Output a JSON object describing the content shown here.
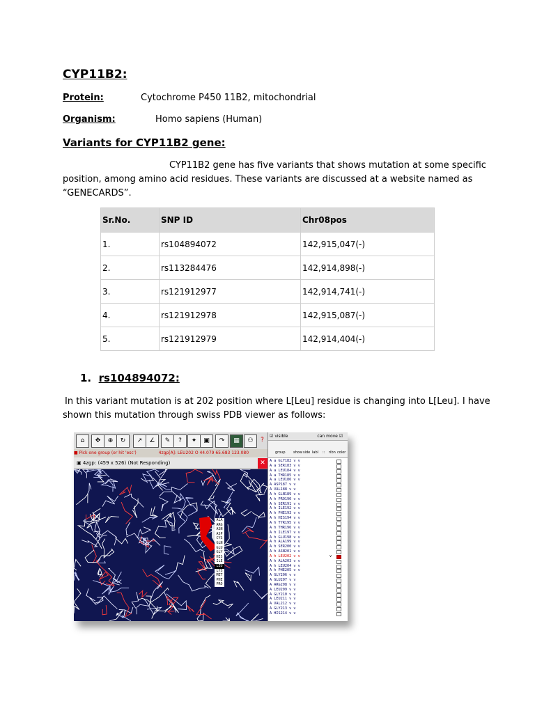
{
  "title": "CYP11B2:",
  "protein": {
    "label": "Protein:",
    "value": "Cytochrome P450 11B2, mitochondrial"
  },
  "organism": {
    "label": "Organism:",
    "value": "Homo sapiens (Human)"
  },
  "variants_heading": "Variants for CYP11B2 gene:",
  "intro_lines": [
    "CYP11B2 gene has  five variants that shows mutation at some specific",
    "position, among amino acid residues. These variants are discussed at a website named as",
    "“GENECARDS”."
  ],
  "table": {
    "headers": [
      "Sr.No.",
      "SNP ID",
      "Chr08pos"
    ],
    "rows": [
      [
        "1.",
        "rs104894072",
        "142,915,047(-)"
      ],
      [
        "2.",
        "rs113284476",
        "142,914,898(-)"
      ],
      [
        "3.",
        "rs121912977",
        "142,914,741(-)"
      ],
      [
        "4.",
        "rs121912978",
        "142,915,087(-)"
      ],
      [
        "5.",
        "rs121912979",
        "142,914,404(-)"
      ]
    ]
  },
  "section": {
    "number": "1.",
    "title": "rs104894072:"
  },
  "section_lines": [
    "In this variant mutation is at 202 position where L[Leu] residue is changing into L[Leu]. I have",
    "shown this mutation through swiss PDB viewer as follows:"
  ],
  "figure": {
    "pick_text": "Pick one group (or hit 'esc')",
    "status_text": "4zgp[A]: LEU202  O   44.079  65.683 123.080",
    "window_title": "4zgp: (459 x 526) (Not Responding)",
    "panel_top": [
      "visible",
      "can move"
    ],
    "panel_headers": [
      "group",
      "show",
      "side",
      "labl",
      "::",
      "ribn",
      "color"
    ],
    "residue_menu": [
      "ALA",
      "ARG",
      "ASN",
      "ASP",
      "CYS",
      "GLN",
      "GLU",
      "GLY",
      "HIS",
      "ILE",
      "LEU",
      "LYS",
      "MET",
      "PHE",
      "PRO"
    ],
    "residue_menu_selected": "LEU",
    "panel_rows": [
      "A  a GLY182",
      "A  a SER183",
      "A  a LEU184",
      "A  a THR185",
      "A  a LEU186",
      "A    ASP187",
      "A    VAL188",
      "A  h GLN189",
      "A  h PRO190",
      "A  h SER191",
      "A  h ILE192",
      "A  h PHE193",
      "A  h HIS194",
      "A  h TYR195",
      "A  h THR196",
      "A  h ILE197",
      "A  h GLU198",
      "A  h ALA199",
      "A  h SER200",
      "A  h ASN201",
      "A  h LEU202",
      "A  h ALA203",
      "A  h LEU204",
      "A  h PHE205",
      "A    GLY206",
      "A    GLU207",
      "A    ARG208",
      "A    LEU209",
      "A    GLY210",
      "A    LEU211",
      "A    VAL212",
      "A    GLY213",
      "A    HIS214"
    ],
    "highlight_row": 20,
    "colors": {
      "background": "#101650",
      "mutation": "#e00000"
    }
  }
}
